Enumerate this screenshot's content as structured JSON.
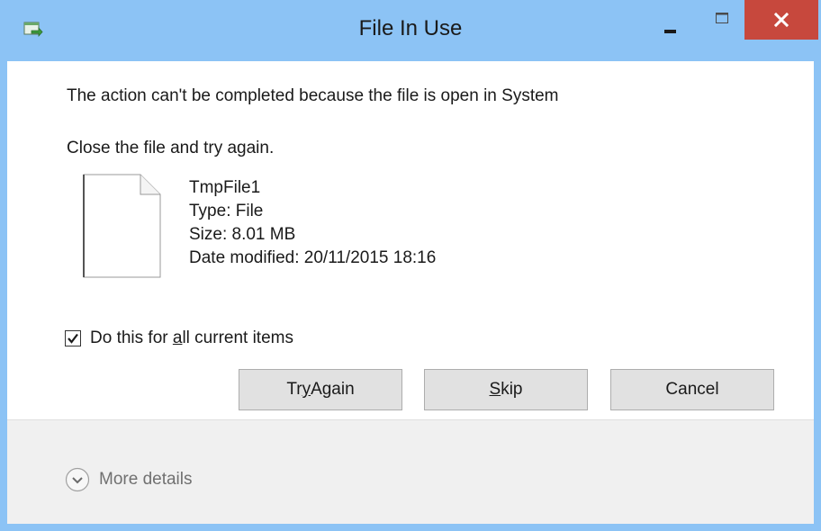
{
  "window": {
    "title": "File In Use"
  },
  "dialog": {
    "message": "The action can't be completed because the file is open in System",
    "instruction": "Close the file and try again."
  },
  "file": {
    "name": "TmpFile1",
    "type": "Type: File",
    "size": "Size: 8.01 MB",
    "date_modified": "Date modified: 20/11/2015 18:16"
  },
  "checkbox": {
    "label_prefix": "Do this for ",
    "label_underlined": "a",
    "label_suffix": "ll current items",
    "checked": true
  },
  "buttons": {
    "try_again_prefix": "Tr",
    "try_again_underlined": "y",
    "try_again_suffix": " Again",
    "skip_underlined": "S",
    "skip_suffix": "kip",
    "cancel": "Cancel"
  },
  "footer": {
    "more_details": "More details"
  },
  "colors": {
    "titlebar": "#8cc3f5",
    "close_button": "#c7483d",
    "button_face": "#e1e1e1",
    "footer": "#f0f0f0"
  },
  "icons": {
    "app": "transfer-icon",
    "minimize": "minimize-icon",
    "maximize": "maximize-icon",
    "close": "close-icon",
    "file": "document-icon",
    "check": "checkmark-icon",
    "expand": "chevron-down-icon"
  }
}
